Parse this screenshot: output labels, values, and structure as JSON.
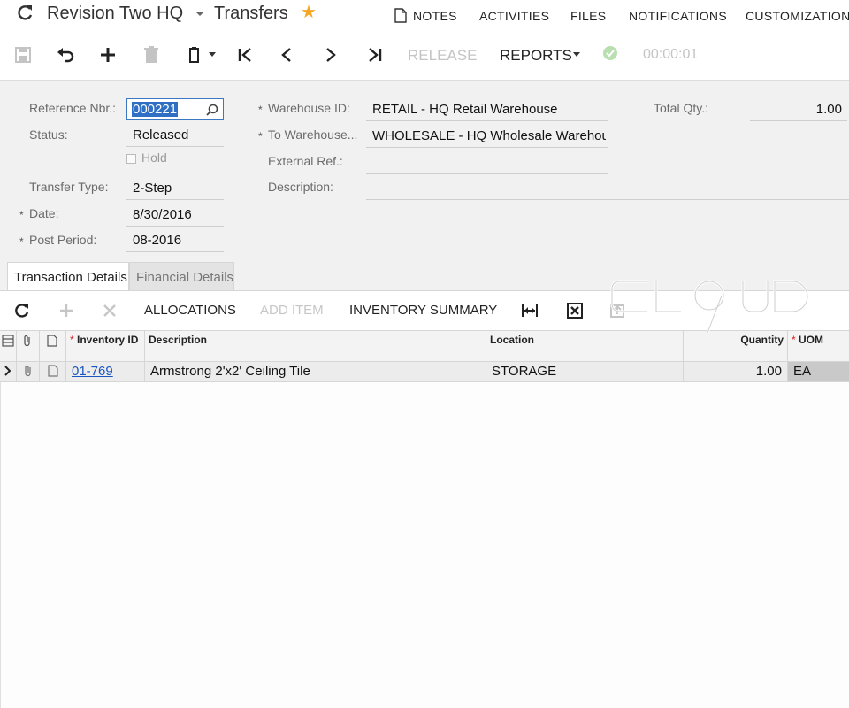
{
  "header": {
    "company": "Revision Two HQ",
    "screen_title": "Transfers",
    "links": {
      "notes": "NOTES",
      "activities": "ACTIVITIES",
      "files": "FILES",
      "notifications": "NOTIFICATIONS",
      "customization": "CUSTOMIZATION"
    },
    "favorite_color": "#f5a623"
  },
  "toolbar": {
    "release": "RELEASE",
    "reports": "REPORTS",
    "timer": "00:00:01"
  },
  "form": {
    "reference_nbr": {
      "label": "Reference Nbr.:",
      "value": "000221"
    },
    "status": {
      "label": "Status:",
      "value": "Released"
    },
    "hold": {
      "label": "Hold",
      "checked": false
    },
    "transfer_type": {
      "label": "Transfer Type:",
      "value": "2-Step"
    },
    "date": {
      "label": "Date:",
      "value": "8/30/2016"
    },
    "post_period": {
      "label": "Post Period:",
      "value": "08-2016"
    },
    "warehouse_id": {
      "label": "Warehouse ID:",
      "value": "RETAIL - HQ Retail Warehouse"
    },
    "to_warehouse": {
      "label": "To Warehouse...",
      "value": "WHOLESALE - HQ Wholesale Warehouse"
    },
    "external_ref": {
      "label": "External Ref.:",
      "value": ""
    },
    "description": {
      "label": "Description:",
      "value": ""
    },
    "total_qty": {
      "label": "Total Qty.:",
      "value": "1.00"
    },
    "required_mark": "*"
  },
  "tabs": [
    {
      "label": "Transaction Details",
      "active": true
    },
    {
      "label": "Financial Details",
      "active": false
    }
  ],
  "grid_toolbar": {
    "allocations": "ALLOCATIONS",
    "add_item": "ADD ITEM",
    "inventory_summary": "INVENTORY SUMMARY"
  },
  "grid": {
    "columns": {
      "inventory_id": "Inventory ID",
      "description": "Description",
      "location": "Location",
      "quantity": "Quantity",
      "uom": "UOM"
    },
    "rows": [
      {
        "inventory_id": "01-769",
        "description": "Armstrong 2'x2' Ceiling Tile",
        "location": "STORAGE",
        "quantity": "1.00",
        "uom": "EA"
      }
    ]
  },
  "colors": {
    "accent": "#2f6fc4",
    "form_bg": "#f1f1f1",
    "link": "#1a55c0"
  }
}
